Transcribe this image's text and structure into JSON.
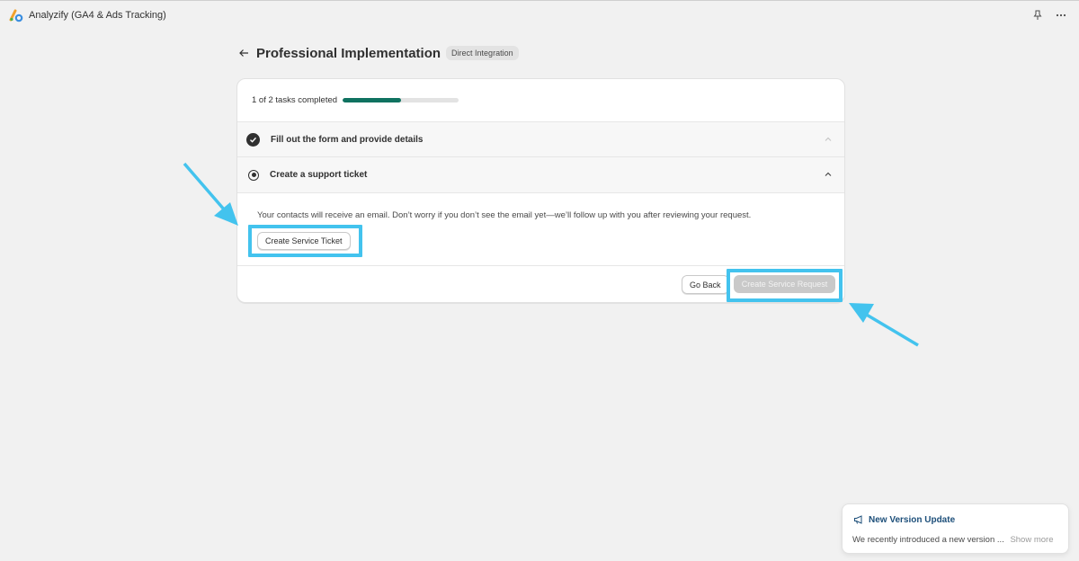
{
  "app": {
    "title": "Analyzify (GA4 & Ads Tracking)",
    "icons": {
      "logo": "analyzify-logo",
      "pin": "pin-icon",
      "more": "more-icon"
    }
  },
  "header": {
    "title": "Professional Implementation",
    "badge": "Direct Integration"
  },
  "progress": {
    "text": "1 of 2 tasks completed",
    "completed": 1,
    "total": 2,
    "fraction": 0.5
  },
  "tasks": [
    {
      "label": "Fill out the form and provide details",
      "status": "completed",
      "expanded": false
    },
    {
      "label": "Create a support ticket",
      "status": "current",
      "expanded": true,
      "description": "Your contacts will receive an email. Don’t worry if you don’t see the email yet—we’ll follow up with you after reviewing your request.",
      "button": "Create Service Ticket"
    }
  ],
  "footer": {
    "go_back": "Go Back",
    "create_request": "Create Service Request"
  },
  "toast": {
    "title": "New Version Update",
    "body": "We recently introduced a new version ...",
    "link": "Show more"
  },
  "colors": {
    "accent": "#0f7260",
    "highlight": "#43c3ee",
    "toast_title": "#1d4f7a",
    "disabled_button": "#c9c9c9"
  }
}
